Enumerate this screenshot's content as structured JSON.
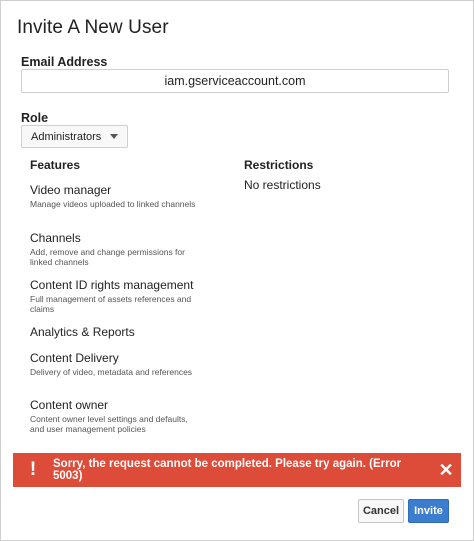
{
  "dialog": {
    "title": "Invite A New User",
    "email": {
      "label": "Email Address",
      "value": "iam.gserviceaccount.com",
      "placeholder": ""
    },
    "role": {
      "label": "Role",
      "selected": "Administrators"
    },
    "features_header": "Features",
    "restrictions_header": "Restrictions",
    "restriction_text": "No restrictions",
    "features": [
      {
        "name": "Video manager",
        "desc": "Manage videos uploaded to linked channels"
      },
      {
        "name": "Channels",
        "desc": "Add, remove and change permissions for linked channels"
      },
      {
        "name": "Content ID rights management",
        "desc": "Full management of assets references and claims"
      },
      {
        "name": "Analytics & Reports",
        "desc": ""
      },
      {
        "name": "Content Delivery",
        "desc": "Delivery of video, metadata and references"
      },
      {
        "name": "Content owner",
        "desc": "Content owner level settings and defaults, and user management policies"
      }
    ],
    "error": {
      "icon": "!",
      "message": "Sorry, the request cannot be completed. Please try again. (Error 5003)",
      "close": "✕",
      "color": "#dd4b39"
    },
    "buttons": {
      "cancel": "Cancel",
      "invite": "Invite"
    },
    "accent": "#3b7ed0"
  }
}
